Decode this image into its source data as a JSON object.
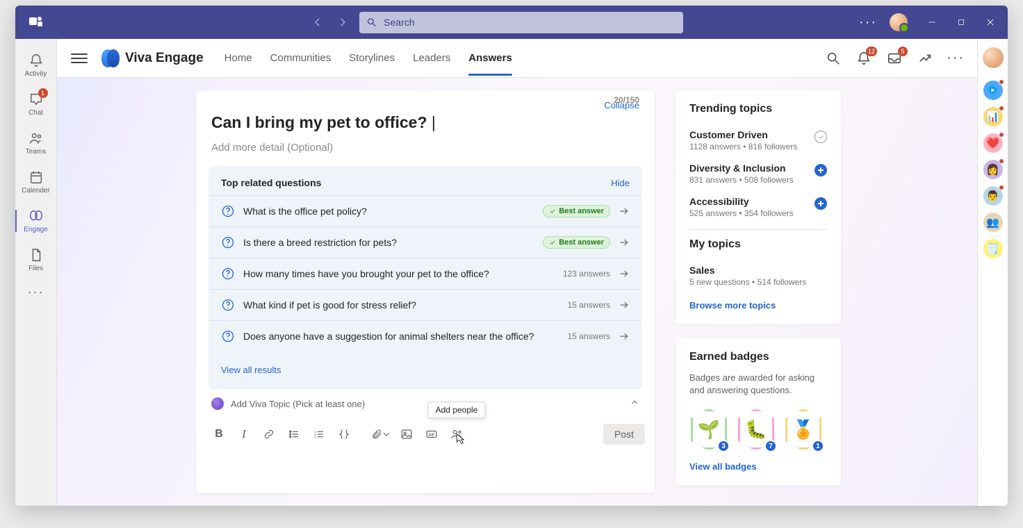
{
  "titlebar": {
    "search_placeholder": "Search"
  },
  "leftrail": {
    "items": [
      {
        "key": "activity",
        "label": "Activity"
      },
      {
        "key": "chat",
        "label": "Chat",
        "badge": "1"
      },
      {
        "key": "teams",
        "label": "Teams"
      },
      {
        "key": "calendar",
        "label": "Calender"
      },
      {
        "key": "engage",
        "label": "Engage"
      },
      {
        "key": "files",
        "label": "Files"
      }
    ]
  },
  "engage": {
    "product_name": "Viva Engage",
    "tabs": [
      {
        "label": "Home"
      },
      {
        "label": "Communities"
      },
      {
        "label": "Storylines"
      },
      {
        "label": "Leaders"
      },
      {
        "label": "Answers",
        "active": true
      }
    ],
    "header_badges": {
      "notifications": "12",
      "inbox": "5"
    }
  },
  "compose": {
    "collapse_label": "Collapse",
    "title": "Can I bring my pet to office? ",
    "counter": "20/150",
    "detail_placeholder": "Add more detail (Optional)",
    "related": {
      "title": "Top related questions",
      "hide_label": "Hide",
      "best_answer_label": "Best answer",
      "items": [
        {
          "text": "What is the office pet policy?",
          "best": true
        },
        {
          "text": "Is there a breed restriction for pets?",
          "best": true
        },
        {
          "text": "How many times have you brought your pet to the office?",
          "meta": "123 answers"
        },
        {
          "text": "What kind if pet is good for stress relief?",
          "meta": "15 answers"
        },
        {
          "text": "Does anyone have a suggestion for animal shelters near the office?",
          "meta": "15 answers"
        }
      ],
      "view_all": "View all results"
    },
    "topic_row": "Add Viva Topic (Pick at least one)",
    "toolbar": {
      "add_people_tooltip": "Add people",
      "post_label": "Post"
    }
  },
  "sidebar": {
    "trending": {
      "title": "Trending topics",
      "items": [
        {
          "name": "Customer Driven",
          "meta": "1128 answers • 816 followers",
          "action": "check"
        },
        {
          "name": "Diversity & Inclusion",
          "meta": "831 answers • 508 followers",
          "action": "add"
        },
        {
          "name": "Accessibility",
          "meta": "525 answers • 354 followers",
          "action": "add"
        }
      ],
      "my_title": "My topics",
      "my_items": [
        {
          "name": "Sales",
          "meta": "5 new questions • 514 followers"
        }
      ],
      "browse": "Browse more topics"
    },
    "badges": {
      "title": "Earned badges",
      "desc": "Badges are awarded for asking and answering questions.",
      "items": [
        {
          "emoji": "🌱",
          "count": "3",
          "tone": "g"
        },
        {
          "emoji": "🐛",
          "count": "7",
          "tone": "p"
        },
        {
          "emoji": "🏅",
          "count": "1",
          "tone": "y"
        }
      ],
      "view_all": "View all badges"
    }
  },
  "rightrail": {
    "items": [
      {
        "bg": "radial-gradient(circle at 30% 30%,#ffe0c0,#d68a5a)"
      },
      {
        "bg": "#4fa7ff",
        "dot": true,
        "emoji": "💠"
      },
      {
        "bg": "#ffd76a",
        "dot": true,
        "emoji": "📊"
      },
      {
        "bg": "#ffb0c2",
        "dot": true,
        "emoji": "❤️"
      },
      {
        "bg": "#c7b6e8",
        "dot": true,
        "emoji": "👩"
      },
      {
        "bg": "#b6d6e8",
        "dot": true,
        "emoji": "👨"
      },
      {
        "bg": "#e8d4b6",
        "emoji": "👥"
      },
      {
        "bg": "#fff27a",
        "emoji": "🗒️"
      }
    ]
  }
}
